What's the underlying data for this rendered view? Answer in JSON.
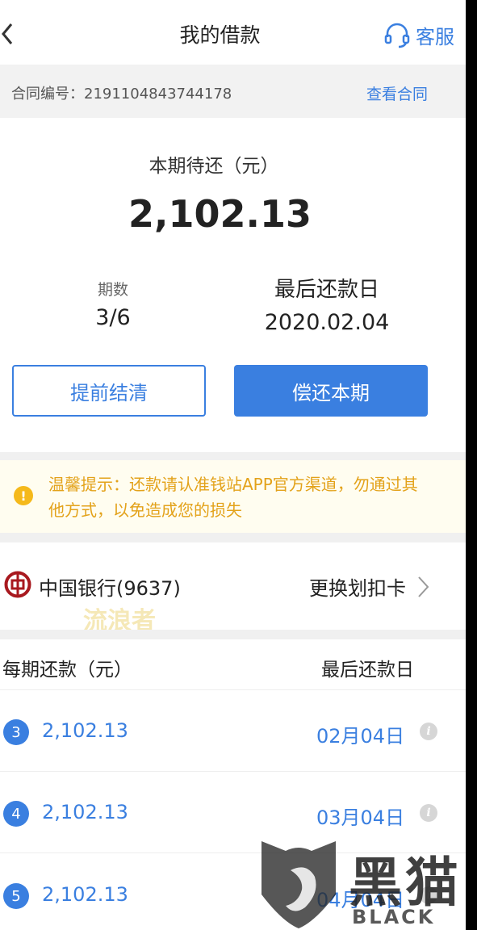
{
  "header": {
    "back_icon": "chevron-left-icon",
    "title": "我的借款",
    "service_icon": "headset-icon",
    "service_label": "客服"
  },
  "contract": {
    "number_label": "合同编号：2191104843744178",
    "view_link": "查看合同"
  },
  "summary": {
    "due_label": "本期待还（元）",
    "due_amount": "2,102.13",
    "periods_label": "期数",
    "periods_value": "3/6",
    "last_date_label": "最后还款日",
    "last_date_value": "2020.02.04",
    "settle_button": "提前结清",
    "repay_button": "偿还本期"
  },
  "notice": {
    "icon": "warning-icon",
    "text": "温馨提示：还款请认准钱站APP官方渠道，勿通过其他方式，以免造成您的损失"
  },
  "bank": {
    "icon": "bank-of-china-logo",
    "name": "中国银行(9637)",
    "change_label": "更换划扣卡",
    "watermark": "流浪者"
  },
  "schedule": {
    "col_amount": "每期还款（元）",
    "col_date": "最后还款日",
    "rows": [
      {
        "num": "3",
        "amount": "2,102.13",
        "date": "02月04日"
      },
      {
        "num": "4",
        "amount": "2,102.13",
        "date": "03月04日"
      },
      {
        "num": "5",
        "amount": "2,102.13",
        "date": "04月04日"
      }
    ]
  },
  "watermark_brand": {
    "cn": "黑猫",
    "en": "BLACK CAT"
  },
  "colors": {
    "accent": "#3a7fe0",
    "warning": "#e3a21a",
    "bank_red": "#a8191f"
  }
}
